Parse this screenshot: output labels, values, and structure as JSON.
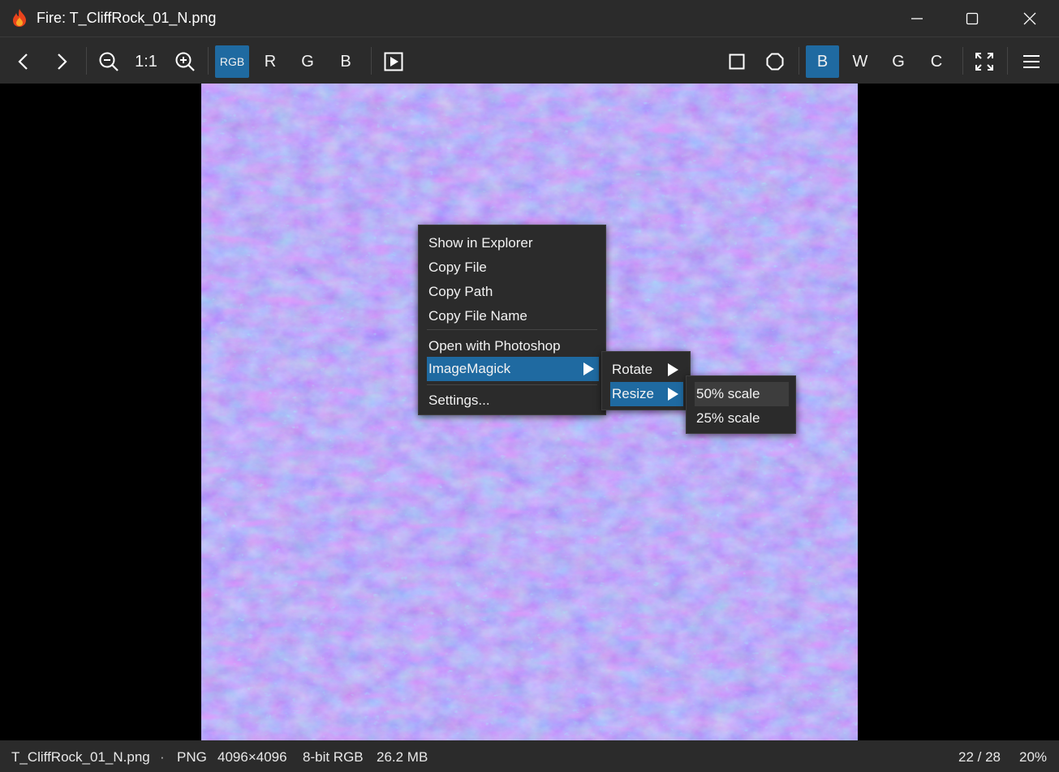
{
  "window": {
    "title": "Fire: T_CliffRock_01_N.png",
    "controls": [
      "minimize",
      "maximize",
      "close"
    ]
  },
  "toolbar": {
    "back_icon": "chevron-left-icon",
    "forward_icon": "chevron-right-icon",
    "zoom_out_icon": "zoom-out-icon",
    "actual_size_label": "1:1",
    "zoom_in_icon": "zoom-in-icon",
    "channel_rgb_label": "RGB",
    "channel_r_label": "R",
    "channel_g_label": "G",
    "channel_b_label": "B",
    "slideshow_icon": "play-icon",
    "square_icon": "square-icon",
    "circle_icon": "circle-icon",
    "bg_black_label": "B",
    "bg_white_label": "W",
    "bg_gray_label": "G",
    "bg_checker_label": "C",
    "fullscreen_icon": "fullscreen-icon",
    "menu_icon": "hamburger-menu-icon",
    "active_channel": "RGB",
    "active_background": "B"
  },
  "context_menu": {
    "items": [
      {
        "label": "Show in Explorer"
      },
      {
        "label": "Copy File"
      },
      {
        "label": "Copy Path"
      },
      {
        "label": "Copy File Name"
      },
      {
        "label": "Open with Photoshop"
      },
      {
        "label": "ImageMagick"
      },
      {
        "label": "Settings..."
      }
    ],
    "selected": "ImageMagick"
  },
  "imagemagick_menu": {
    "items": [
      {
        "label": "Rotate"
      },
      {
        "label": "Resize"
      }
    ],
    "selected": "Resize"
  },
  "resize_menu": {
    "items": [
      {
        "label": "50% scale"
      },
      {
        "label": "25% scale"
      }
    ],
    "hovered": "50% scale"
  },
  "status": {
    "filename": "T_CliffRock_01_N.png",
    "separator": "·",
    "format": "PNG",
    "dimensions": "4096×4096",
    "bit_depth": "8-bit RGB",
    "file_size": "26.2 MB",
    "position": "22 / 28",
    "zoom": "20%"
  },
  "colors": {
    "chrome": "#2b2b2b",
    "accent": "#1f6aa1",
    "normal_map_base": "#8b80f6"
  }
}
